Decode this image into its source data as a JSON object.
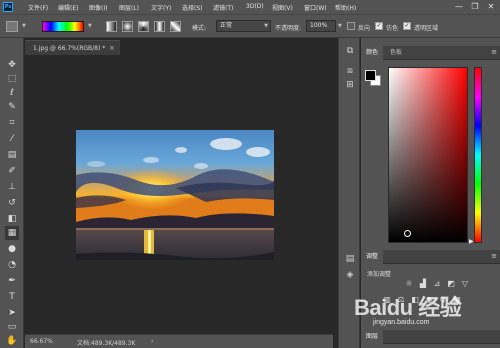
{
  "menubar": {
    "logo": "Ps",
    "items": [
      "文件(F)",
      "编辑(E)",
      "图像(I)",
      "图层(L)",
      "文字(Y)",
      "选择(S)",
      "滤镜(T)",
      "3D(D)",
      "视图(V)",
      "窗口(W)",
      "帮助(H)"
    ],
    "minimize": "—",
    "restore": "❐",
    "close": "✕"
  },
  "options": {
    "mode_label": "模式:",
    "mode_value": "正常",
    "opacity_label": "不透明度:",
    "opacity_value": "100%",
    "reverse_label": "反向",
    "dither_label": "仿色",
    "transparency_label": "透明区域",
    "check_mark": "✓"
  },
  "document": {
    "tab_label": "1.jpg @ 66.7%(RGB/8) *",
    "close": "×"
  },
  "status": {
    "zoom": "66.67%",
    "doc_info": "文档:489.3K/489.3K",
    "arrow": "›"
  },
  "toolbar": {
    "icons": [
      "move-icon",
      "marquee-icon",
      "lasso-icon",
      "quick-select-icon",
      "crop-icon",
      "eyedropper-icon",
      "healing-brush-icon",
      "brush-icon",
      "clone-stamp-icon",
      "history-brush-icon",
      "eraser-icon",
      "gradient-icon",
      "blur-icon",
      "dodge-icon",
      "pen-icon",
      "type-icon",
      "path-select-icon",
      "rectangle-icon",
      "hand-icon"
    ]
  },
  "panels": {
    "color_tab": "颜色",
    "swatches_tab": "色板",
    "adjust_tab": "调整",
    "adjust_title": "添加调整",
    "bottom_tab": "图层",
    "menu_glyph": "≡"
  },
  "watermark": {
    "text": "Baidu 经验",
    "url": "jingyan.baidu.com"
  },
  "colors": {
    "ui_bg": "#535353",
    "canvas_bg": "#282828",
    "accent": "#31a8ff"
  }
}
